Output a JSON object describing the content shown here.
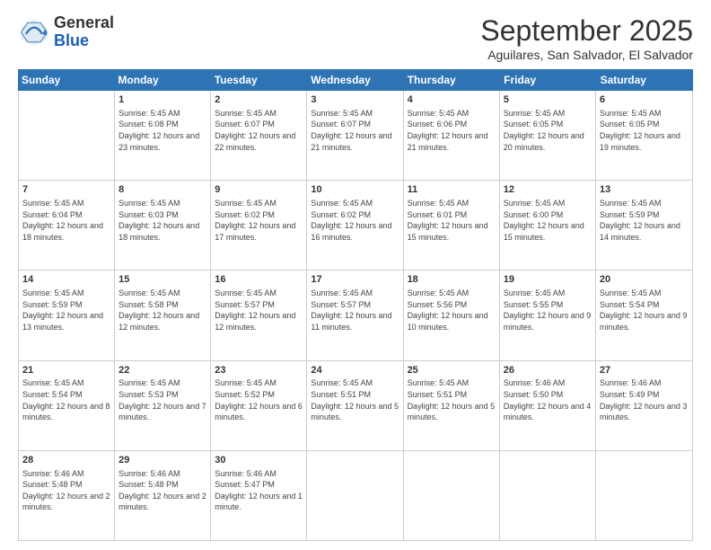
{
  "header": {
    "logo": {
      "line1": "General",
      "line2": "Blue"
    },
    "title": "September 2025",
    "subtitle": "Aguilares, San Salvador, El Salvador"
  },
  "weekdays": [
    "Sunday",
    "Monday",
    "Tuesday",
    "Wednesday",
    "Thursday",
    "Friday",
    "Saturday"
  ],
  "weeks": [
    [
      {
        "day": null
      },
      {
        "day": "1",
        "sunrise": "Sunrise: 5:45 AM",
        "sunset": "Sunset: 6:08 PM",
        "daylight": "Daylight: 12 hours and 23 minutes."
      },
      {
        "day": "2",
        "sunrise": "Sunrise: 5:45 AM",
        "sunset": "Sunset: 6:07 PM",
        "daylight": "Daylight: 12 hours and 22 minutes."
      },
      {
        "day": "3",
        "sunrise": "Sunrise: 5:45 AM",
        "sunset": "Sunset: 6:07 PM",
        "daylight": "Daylight: 12 hours and 21 minutes."
      },
      {
        "day": "4",
        "sunrise": "Sunrise: 5:45 AM",
        "sunset": "Sunset: 6:06 PM",
        "daylight": "Daylight: 12 hours and 21 minutes."
      },
      {
        "day": "5",
        "sunrise": "Sunrise: 5:45 AM",
        "sunset": "Sunset: 6:05 PM",
        "daylight": "Daylight: 12 hours and 20 minutes."
      },
      {
        "day": "6",
        "sunrise": "Sunrise: 5:45 AM",
        "sunset": "Sunset: 6:05 PM",
        "daylight": "Daylight: 12 hours and 19 minutes."
      }
    ],
    [
      {
        "day": "7",
        "sunrise": "Sunrise: 5:45 AM",
        "sunset": "Sunset: 6:04 PM",
        "daylight": "Daylight: 12 hours and 18 minutes."
      },
      {
        "day": "8",
        "sunrise": "Sunrise: 5:45 AM",
        "sunset": "Sunset: 6:03 PM",
        "daylight": "Daylight: 12 hours and 18 minutes."
      },
      {
        "day": "9",
        "sunrise": "Sunrise: 5:45 AM",
        "sunset": "Sunset: 6:02 PM",
        "daylight": "Daylight: 12 hours and 17 minutes."
      },
      {
        "day": "10",
        "sunrise": "Sunrise: 5:45 AM",
        "sunset": "Sunset: 6:02 PM",
        "daylight": "Daylight: 12 hours and 16 minutes."
      },
      {
        "day": "11",
        "sunrise": "Sunrise: 5:45 AM",
        "sunset": "Sunset: 6:01 PM",
        "daylight": "Daylight: 12 hours and 15 minutes."
      },
      {
        "day": "12",
        "sunrise": "Sunrise: 5:45 AM",
        "sunset": "Sunset: 6:00 PM",
        "daylight": "Daylight: 12 hours and 15 minutes."
      },
      {
        "day": "13",
        "sunrise": "Sunrise: 5:45 AM",
        "sunset": "Sunset: 5:59 PM",
        "daylight": "Daylight: 12 hours and 14 minutes."
      }
    ],
    [
      {
        "day": "14",
        "sunrise": "Sunrise: 5:45 AM",
        "sunset": "Sunset: 5:59 PM",
        "daylight": "Daylight: 12 hours and 13 minutes."
      },
      {
        "day": "15",
        "sunrise": "Sunrise: 5:45 AM",
        "sunset": "Sunset: 5:58 PM",
        "daylight": "Daylight: 12 hours and 12 minutes."
      },
      {
        "day": "16",
        "sunrise": "Sunrise: 5:45 AM",
        "sunset": "Sunset: 5:57 PM",
        "daylight": "Daylight: 12 hours and 12 minutes."
      },
      {
        "day": "17",
        "sunrise": "Sunrise: 5:45 AM",
        "sunset": "Sunset: 5:57 PM",
        "daylight": "Daylight: 12 hours and 11 minutes."
      },
      {
        "day": "18",
        "sunrise": "Sunrise: 5:45 AM",
        "sunset": "Sunset: 5:56 PM",
        "daylight": "Daylight: 12 hours and 10 minutes."
      },
      {
        "day": "19",
        "sunrise": "Sunrise: 5:45 AM",
        "sunset": "Sunset: 5:55 PM",
        "daylight": "Daylight: 12 hours and 9 minutes."
      },
      {
        "day": "20",
        "sunrise": "Sunrise: 5:45 AM",
        "sunset": "Sunset: 5:54 PM",
        "daylight": "Daylight: 12 hours and 9 minutes."
      }
    ],
    [
      {
        "day": "21",
        "sunrise": "Sunrise: 5:45 AM",
        "sunset": "Sunset: 5:54 PM",
        "daylight": "Daylight: 12 hours and 8 minutes."
      },
      {
        "day": "22",
        "sunrise": "Sunrise: 5:45 AM",
        "sunset": "Sunset: 5:53 PM",
        "daylight": "Daylight: 12 hours and 7 minutes."
      },
      {
        "day": "23",
        "sunrise": "Sunrise: 5:45 AM",
        "sunset": "Sunset: 5:52 PM",
        "daylight": "Daylight: 12 hours and 6 minutes."
      },
      {
        "day": "24",
        "sunrise": "Sunrise: 5:45 AM",
        "sunset": "Sunset: 5:51 PM",
        "daylight": "Daylight: 12 hours and 5 minutes."
      },
      {
        "day": "25",
        "sunrise": "Sunrise: 5:45 AM",
        "sunset": "Sunset: 5:51 PM",
        "daylight": "Daylight: 12 hours and 5 minutes."
      },
      {
        "day": "26",
        "sunrise": "Sunrise: 5:46 AM",
        "sunset": "Sunset: 5:50 PM",
        "daylight": "Daylight: 12 hours and 4 minutes."
      },
      {
        "day": "27",
        "sunrise": "Sunrise: 5:46 AM",
        "sunset": "Sunset: 5:49 PM",
        "daylight": "Daylight: 12 hours and 3 minutes."
      }
    ],
    [
      {
        "day": "28",
        "sunrise": "Sunrise: 5:46 AM",
        "sunset": "Sunset: 5:48 PM",
        "daylight": "Daylight: 12 hours and 2 minutes."
      },
      {
        "day": "29",
        "sunrise": "Sunrise: 5:46 AM",
        "sunset": "Sunset: 5:48 PM",
        "daylight": "Daylight: 12 hours and 2 minutes."
      },
      {
        "day": "30",
        "sunrise": "Sunrise: 5:46 AM",
        "sunset": "Sunset: 5:47 PM",
        "daylight": "Daylight: 12 hours and 1 minute."
      },
      {
        "day": null
      },
      {
        "day": null
      },
      {
        "day": null
      },
      {
        "day": null
      }
    ]
  ]
}
